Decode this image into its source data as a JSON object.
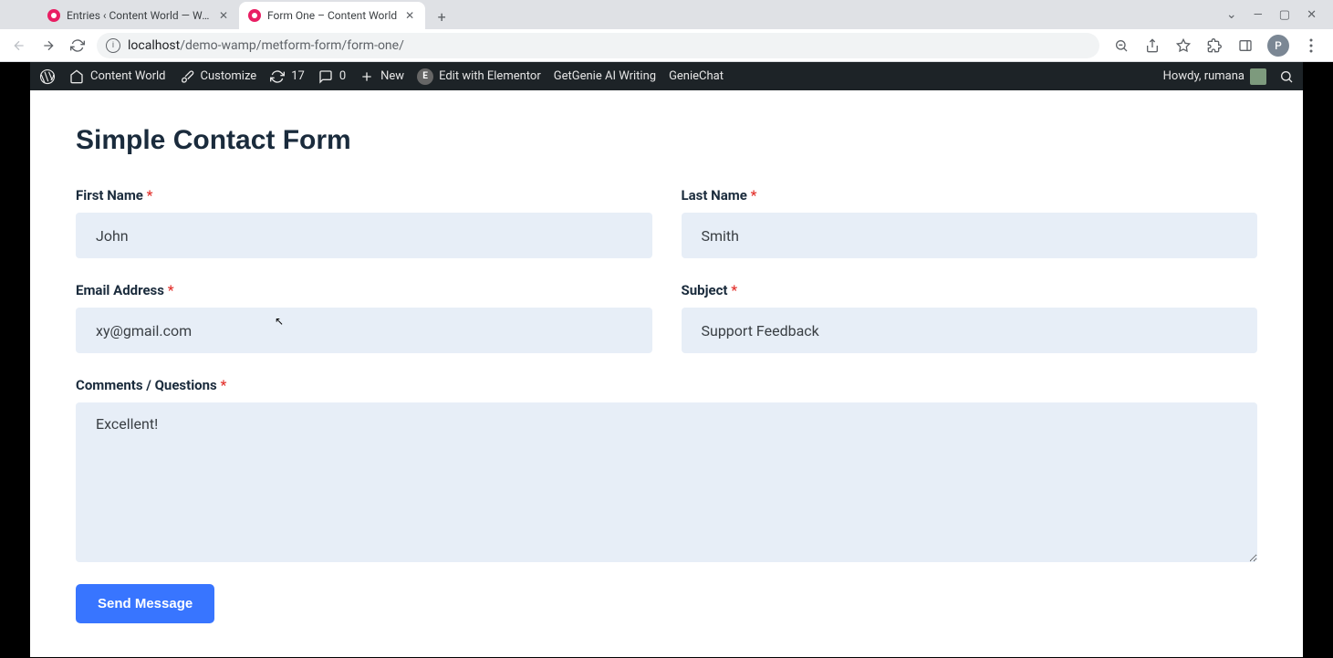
{
  "browser": {
    "tabs": [
      {
        "title": "Entries ‹ Content World — WordP"
      },
      {
        "title": "Form One – Content World"
      }
    ],
    "url_host": "localhost",
    "url_path": "/demo-wamp/metform-form/form-one/",
    "avatar_letter": "P"
  },
  "wpbar": {
    "site_name": "Content World",
    "customize": "Customize",
    "updates_count": "17",
    "comments_count": "0",
    "new_label": "New",
    "elementor": "Edit with Elementor",
    "genie_ai": "GetGenie AI Writing",
    "genie_chat": "GenieChat",
    "howdy": "Howdy, rumana"
  },
  "form": {
    "heading": "Simple Contact Form",
    "first_name": {
      "label": "First Name",
      "value": "John"
    },
    "last_name": {
      "label": "Last Name",
      "value": "Smith"
    },
    "email": {
      "label": "Email Address",
      "value": "xy@gmail.com"
    },
    "subject": {
      "label": "Subject",
      "value": "Support Feedback"
    },
    "comments": {
      "label": "Comments / Questions",
      "value": "Excellent!"
    },
    "submit_label": "Send Message",
    "required_mark": "*"
  }
}
